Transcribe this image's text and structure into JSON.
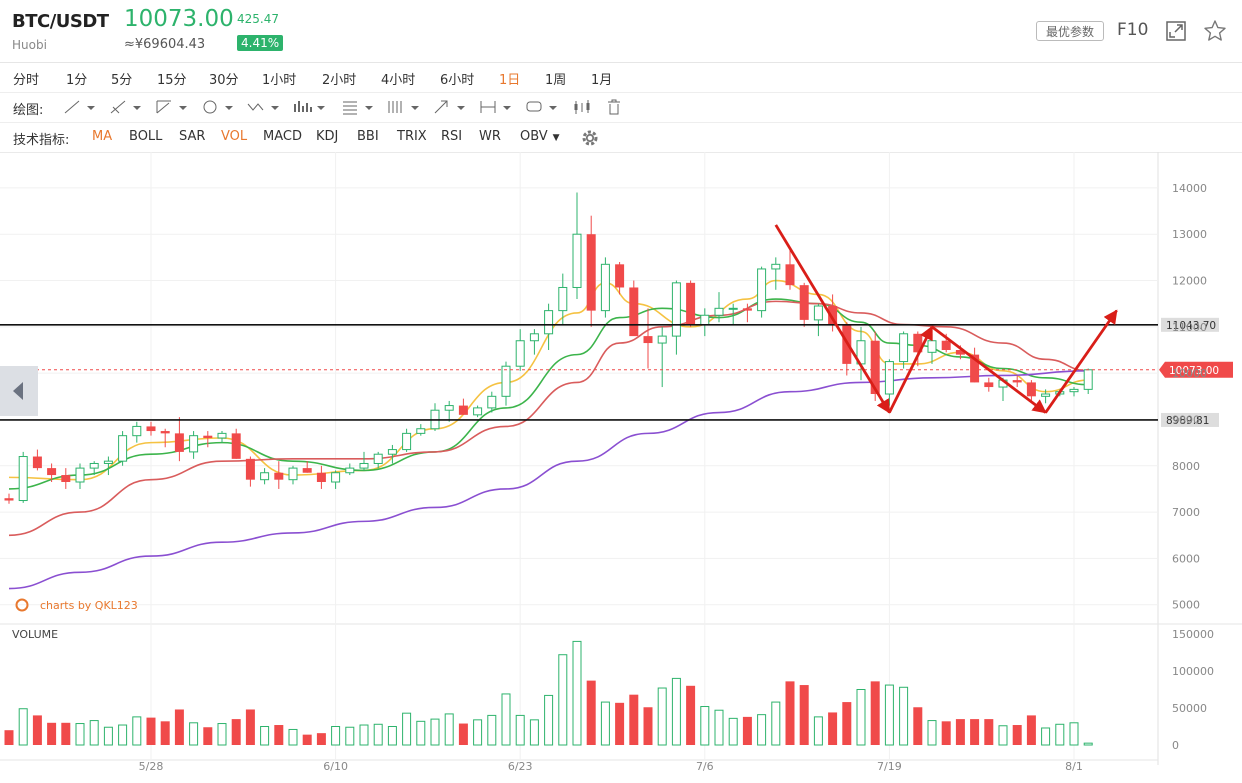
{
  "header": {
    "pair": "BTC/USDT",
    "exchange": "Huobi",
    "price": "10073.00",
    "cny_price": "≈¥69604.43",
    "change": "425.47",
    "change_pct": "4.41%",
    "params_label": "最优参数",
    "f10_label": "F10",
    "expand_icon": "expand-icon",
    "star_icon": "star-icon"
  },
  "periods": {
    "items": [
      "分时",
      "1分",
      "5分",
      "15分",
      "30分",
      "1小时",
      "2小时",
      "4小时",
      "6小时",
      "1日",
      "1周",
      "1月"
    ],
    "active": "1日"
  },
  "drawing_tools": {
    "label": "绘图:",
    "icons": [
      "line-tool-icon",
      "ray-tool-icon",
      "fork-tool-icon",
      "circle-tool-icon",
      "wave-tool-icon",
      "pattern-tool-icon",
      "fib-tool-icon",
      "gann-tool-icon",
      "arrow-tool-icon",
      "range-tool-icon",
      "text-tool-icon",
      "candle-tool-icon",
      "trash-icon"
    ]
  },
  "indicators": {
    "label": "技术指标:",
    "items": [
      "MA",
      "BOLL",
      "SAR",
      "VOL",
      "MACD",
      "KDJ",
      "BBI",
      "TRIX",
      "RSI",
      "WR",
      "OBV"
    ],
    "active": [
      "MA",
      "VOL"
    ],
    "settings_icon": "gear-icon"
  },
  "colors": {
    "up": "#2db36c",
    "down": "#f04a4a",
    "ma5": "#f5c242",
    "ma10": "#3cb44b",
    "ma20": "#d95c5c",
    "ma60": "#8a4fd1",
    "annotation": "#d91e18"
  },
  "chart_data": {
    "type": "candlestick",
    "watermark": "charts by QKL123",
    "price_axis": {
      "ticks": [
        14000,
        13000,
        12000,
        11000,
        10000,
        9000,
        8000,
        7000,
        6000,
        5000
      ],
      "range": [
        4800,
        14300
      ]
    },
    "volume_axis": {
      "label": "VOLUME",
      "ticks": [
        150000,
        100000,
        50000,
        0
      ],
      "range": [
        0,
        150000
      ]
    },
    "date_labels": [
      {
        "label": "5/28",
        "index": 10
      },
      {
        "label": "6/10",
        "index": 23
      },
      {
        "label": "6/23",
        "index": 36
      },
      {
        "label": "7/6",
        "index": 49
      },
      {
        "label": "7/19",
        "index": 62
      },
      {
        "label": "8/1",
        "index": 75
      }
    ],
    "horizontal_lines": [
      {
        "value": 11043.7,
        "label": "11043.70"
      },
      {
        "value": 8989.81,
        "label": "8989.81"
      }
    ],
    "last_price": {
      "value": 10073.0,
      "label": "10073.00"
    },
    "candles": [
      [
        7300,
        7400,
        7180,
        7250
      ],
      [
        7250,
        8300,
        7200,
        8200
      ],
      [
        8200,
        8350,
        7900,
        7950
      ],
      [
        7950,
        8050,
        7650,
        7800
      ],
      [
        7800,
        7950,
        7500,
        7650
      ],
      [
        7650,
        8050,
        7500,
        7950
      ],
      [
        7950,
        8100,
        7800,
        8050
      ],
      [
        8050,
        8200,
        7800,
        8100
      ],
      [
        8100,
        8750,
        8000,
        8650
      ],
      [
        8650,
        8950,
        8500,
        8850
      ],
      [
        8850,
        8950,
        8650,
        8750
      ],
      [
        8750,
        8800,
        8400,
        8700
      ],
      [
        8700,
        9050,
        8100,
        8300
      ],
      [
        8300,
        8750,
        8150,
        8650
      ],
      [
        8650,
        8750,
        8400,
        8600
      ],
      [
        8600,
        8750,
        8500,
        8700
      ],
      [
        8700,
        8800,
        8150,
        8150
      ],
      [
        8150,
        8200,
        7550,
        7700
      ],
      [
        7700,
        7950,
        7600,
        7850
      ],
      [
        7850,
        8100,
        7500,
        7700
      ],
      [
        7700,
        8000,
        7600,
        7950
      ],
      [
        7950,
        8100,
        7850,
        7850
      ],
      [
        7850,
        8000,
        7500,
        7650
      ],
      [
        7650,
        7900,
        7500,
        7850
      ],
      [
        7850,
        8050,
        7800,
        7950
      ],
      [
        7950,
        8300,
        7900,
        8050
      ],
      [
        8050,
        8300,
        7950,
        8250
      ],
      [
        8250,
        8450,
        8050,
        8350
      ],
      [
        8350,
        8800,
        8300,
        8700
      ],
      [
        8700,
        8900,
        8650,
        8800
      ],
      [
        8800,
        9350,
        8750,
        9200
      ],
      [
        9200,
        9400,
        8950,
        9300
      ],
      [
        9300,
        9450,
        9100,
        9100
      ],
      [
        9100,
        9300,
        9050,
        9250
      ],
      [
        9250,
        9600,
        9150,
        9500
      ],
      [
        9500,
        10250,
        9300,
        10150
      ],
      [
        10150,
        10950,
        10050,
        10700
      ],
      [
        10700,
        10950,
        10400,
        10850
      ],
      [
        10850,
        11500,
        10500,
        11350
      ],
      [
        11350,
        12150,
        11050,
        11850
      ],
      [
        11850,
        13900,
        11600,
        13000
      ],
      [
        13000,
        13400,
        11000,
        11350
      ],
      [
        11350,
        12500,
        11200,
        12350
      ],
      [
        12350,
        12400,
        11700,
        11850
      ],
      [
        11850,
        12000,
        10900,
        10800
      ],
      [
        10800,
        11400,
        10100,
        10650
      ],
      [
        10650,
        11000,
        9700,
        10800
      ],
      [
        10800,
        12000,
        10400,
        11950
      ],
      [
        11950,
        12000,
        11000,
        11050
      ],
      [
        11050,
        11400,
        10800,
        11250
      ],
      [
        11250,
        11750,
        11100,
        11400
      ],
      [
        11400,
        11500,
        11050,
        11400
      ],
      [
        11400,
        11500,
        11100,
        11350
      ],
      [
        11350,
        12300,
        11200,
        12250
      ],
      [
        12250,
        12500,
        11800,
        12350
      ],
      [
        12350,
        12700,
        11800,
        11900
      ],
      [
        11900,
        11950,
        11000,
        11150
      ],
      [
        11150,
        11500,
        10800,
        11450
      ],
      [
        11450,
        11700,
        10900,
        11050
      ],
      [
        11050,
        11100,
        9950,
        10200
      ],
      [
        10200,
        11000,
        9850,
        10700
      ],
      [
        10700,
        10900,
        9400,
        9550
      ],
      [
        9550,
        10300,
        9300,
        10250
      ],
      [
        10250,
        10900,
        10100,
        10850
      ],
      [
        10850,
        10900,
        10150,
        10450
      ],
      [
        10450,
        10800,
        10200,
        10700
      ],
      [
        10700,
        10850,
        10450,
        10500
      ],
      [
        10500,
        10600,
        10300,
        10400
      ],
      [
        10400,
        10550,
        9800,
        9800
      ],
      [
        9800,
        9900,
        9600,
        9700
      ],
      [
        9700,
        9900,
        9400,
        9850
      ],
      [
        9850,
        9950,
        9700,
        9800
      ],
      [
        9800,
        9850,
        9400,
        9500
      ],
      [
        9500,
        9650,
        9350,
        9550
      ],
      [
        9550,
        9650,
        9500,
        9600
      ],
      [
        9600,
        9700,
        9500,
        9650
      ],
      [
        9650,
        10100,
        9550,
        10073
      ]
    ],
    "volumes": [
      20000,
      49000,
      40000,
      30000,
      30000,
      29000,
      33000,
      24000,
      27000,
      38000,
      37000,
      32000,
      48000,
      30000,
      24000,
      29000,
      35000,
      48000,
      25000,
      27000,
      21000,
      14000,
      16000,
      25000,
      24000,
      27000,
      28000,
      25000,
      43000,
      32000,
      35000,
      42000,
      29000,
      34000,
      40000,
      69000,
      40000,
      34000,
      67000,
      122000,
      140000,
      87000,
      58000,
      57000,
      68000,
      51000,
      77000,
      90000,
      80000,
      52000,
      47000,
      36000,
      38000,
      41000,
      58000,
      86000,
      81000,
      38000,
      44000,
      58000,
      75000,
      86000,
      81000,
      78000,
      51000,
      33000,
      32000,
      35000,
      35000,
      35000,
      26000,
      27000,
      40000,
      23000,
      28000,
      30000,
      2500
    ],
    "moving_averages": [
      {
        "name": "MA5",
        "color": "#f5c242",
        "points": [
          [
            0,
            7750
          ],
          [
            5,
            7700
          ],
          [
            10,
            8500
          ],
          [
            15,
            8600
          ],
          [
            20,
            7800
          ],
          [
            25,
            7900
          ],
          [
            30,
            8800
          ],
          [
            35,
            9800
          ],
          [
            40,
            11300
          ],
          [
            42,
            11950
          ],
          [
            44,
            11500
          ],
          [
            48,
            11000
          ],
          [
            52,
            11600
          ],
          [
            54,
            12000
          ],
          [
            57,
            11700
          ],
          [
            60,
            10900
          ],
          [
            62,
            10200
          ],
          [
            64,
            10200
          ],
          [
            67,
            10450
          ],
          [
            70,
            10050
          ],
          [
            73,
            9600
          ],
          [
            76,
            9850
          ]
        ]
      },
      {
        "name": "MA10",
        "color": "#3cb44b",
        "points": [
          [
            0,
            7500
          ],
          [
            5,
            7800
          ],
          [
            10,
            8250
          ],
          [
            15,
            8500
          ],
          [
            20,
            8100
          ],
          [
            25,
            7900
          ],
          [
            30,
            8300
          ],
          [
            35,
            9250
          ],
          [
            40,
            10400
          ],
          [
            43,
            11200
          ],
          [
            46,
            11400
          ],
          [
            50,
            11200
          ],
          [
            54,
            11600
          ],
          [
            57,
            11500
          ],
          [
            60,
            11100
          ],
          [
            62,
            10650
          ],
          [
            64,
            10600
          ],
          [
            67,
            10350
          ],
          [
            70,
            10100
          ],
          [
            73,
            9900
          ],
          [
            76,
            9750
          ]
        ]
      },
      {
        "name": "MA20",
        "color": "#d95c5c",
        "points": [
          [
            0,
            6500
          ],
          [
            5,
            7000
          ],
          [
            10,
            7700
          ],
          [
            15,
            8100
          ],
          [
            20,
            8150
          ],
          [
            25,
            8150
          ],
          [
            30,
            8300
          ],
          [
            35,
            8850
          ],
          [
            40,
            9800
          ],
          [
            43,
            10650
          ],
          [
            46,
            11000
          ],
          [
            50,
            11250
          ],
          [
            54,
            11550
          ],
          [
            57,
            11500
          ],
          [
            60,
            11300
          ],
          [
            63,
            11050
          ],
          [
            66,
            11000
          ],
          [
            70,
            10650
          ],
          [
            73,
            10300
          ],
          [
            76,
            10050
          ]
        ]
      },
      {
        "name": "MA60",
        "color": "#8a4fd1",
        "points": [
          [
            0,
            5350
          ],
          [
            5,
            5700
          ],
          [
            10,
            6050
          ],
          [
            15,
            6350
          ],
          [
            20,
            6550
          ],
          [
            25,
            6800
          ],
          [
            30,
            7100
          ],
          [
            35,
            7500
          ],
          [
            40,
            8100
          ],
          [
            45,
            8700
          ],
          [
            50,
            9150
          ],
          [
            55,
            9600
          ],
          [
            60,
            9800
          ],
          [
            65,
            9900
          ],
          [
            70,
            9950
          ],
          [
            76,
            10050
          ]
        ]
      }
    ],
    "annotations": [
      {
        "from": [
          54,
          13200
        ],
        "to": [
          62,
          9150
        ]
      },
      {
        "from": [
          62,
          9150
        ],
        "to": [
          65,
          11000
        ]
      },
      {
        "from": [
          65,
          11000
        ],
        "to": [
          73,
          9150
        ]
      },
      {
        "from": [
          73,
          9150
        ],
        "to": [
          78,
          11350
        ]
      }
    ]
  }
}
